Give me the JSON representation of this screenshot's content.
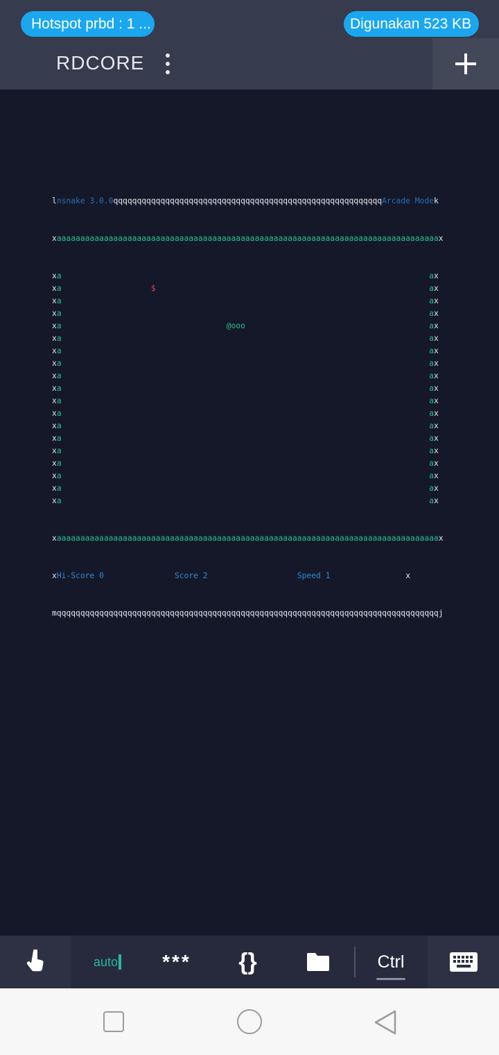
{
  "status_bar": {
    "hotspot_label": "Hotspot prbd : 1 ...",
    "data_usage_label": "Digunakan 523 KB"
  },
  "toolbar": {
    "title": "RDCORE",
    "more_icon": "more-vert-icon",
    "add_icon": "plus-icon"
  },
  "terminal": {
    "version": "nsnake 3.0.0",
    "mode": "Arcade Mode",
    "wall_inner": "aaaaaaaaaaaaaaaaaaaaaaaaaaaaaaaaaaaaaaaaaaaaaaaaaaaaaaaaaaaaaaaaaaaaaaaaaaaaaaaaa",
    "wall_top": "qqqqqqqqqqqqqqqqqqqqqqqqqqqqqqqqqqqqqqqqqqqqqqqqqqqqqqqqq",
    "wall_bottom": "qqqqqqqqqqqqqqqqqqqqqqqqqqqqqqqqqqqqqqqqqqqqqqqqqqqqqqqqqqqqqqqqqqqqqqqqqqqqqqqqq",
    "corner_tl": "l",
    "corner_tr": "k",
    "corner_bl": "m",
    "corner_br": "j",
    "side_char": "x",
    "inner_side_char": "a",
    "food": "$",
    "snake": "@ooo",
    "hi_score_label": "Hi-Score",
    "hi_score": "0",
    "score_label": "Score",
    "score": "2",
    "speed_label": "Speed",
    "speed": "1"
  },
  "action_bar": {
    "touch_icon": "touch-pointer-icon",
    "auto_label": "auto",
    "password_label": "***",
    "braces_label": "{}",
    "folder_icon": "folder-icon",
    "ctrl_label": "Ctrl",
    "keyboard_icon": "keyboard-icon"
  },
  "nav_bar": {
    "recents_icon": "square-recents-icon",
    "home_icon": "circle-home-icon",
    "back_icon": "triangle-back-icon"
  },
  "colors": {
    "background": "#151829",
    "bar": "#363b4e",
    "pill": "#1ba7f0",
    "terminal_green": "#25c08c",
    "terminal_blue": "#2e8bd8",
    "food_red": "#e0424b"
  }
}
